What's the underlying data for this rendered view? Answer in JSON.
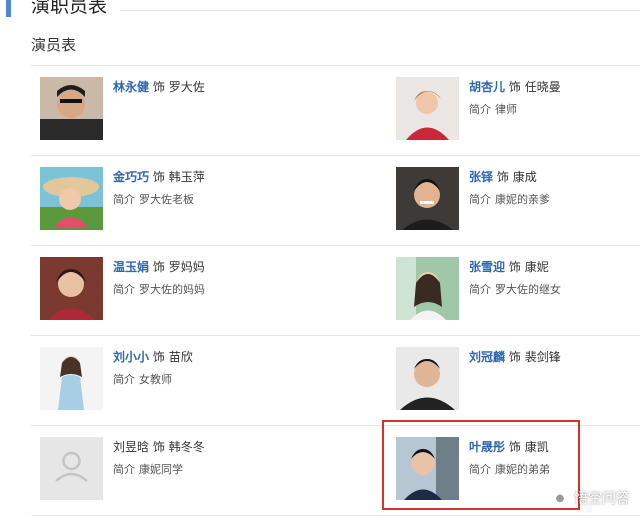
{
  "section": {
    "title": "演职员表"
  },
  "subhead": "演员表",
  "intro_label": "简介",
  "role_connector": "饰",
  "cast": [
    {
      "actor": "林永健",
      "role": "罗大佐",
      "intro": ""
    },
    {
      "actor": "胡杏儿",
      "role": "任晓曼",
      "intro": "律师"
    },
    {
      "actor": "金巧巧",
      "role": "韩玉萍",
      "intro": "罗大佐老板"
    },
    {
      "actor": "张铎",
      "role": "康成",
      "intro": "康妮的亲爹"
    },
    {
      "actor": "温玉娟",
      "role": "罗妈妈",
      "intro": "罗大佐的妈妈"
    },
    {
      "actor": "张雪迎",
      "role": "康妮",
      "intro": "罗大佐的继女"
    },
    {
      "actor": "刘小小",
      "role": "苗欣",
      "intro": "女教师"
    },
    {
      "actor": "刘冠麟",
      "role": "裴剑锋",
      "intro": ""
    },
    {
      "actor": "刘昱晗",
      "role": "韩冬冬",
      "intro": "康妮同学"
    },
    {
      "actor": "叶晟彤",
      "role": "康凯",
      "intro": "康妮的弟弟"
    }
  ],
  "watermark": {
    "text": "悟空问答"
  },
  "colors": {
    "accent": "#4e87d1",
    "actor_link": "#2f67b0",
    "highlight": "#d9302a"
  }
}
